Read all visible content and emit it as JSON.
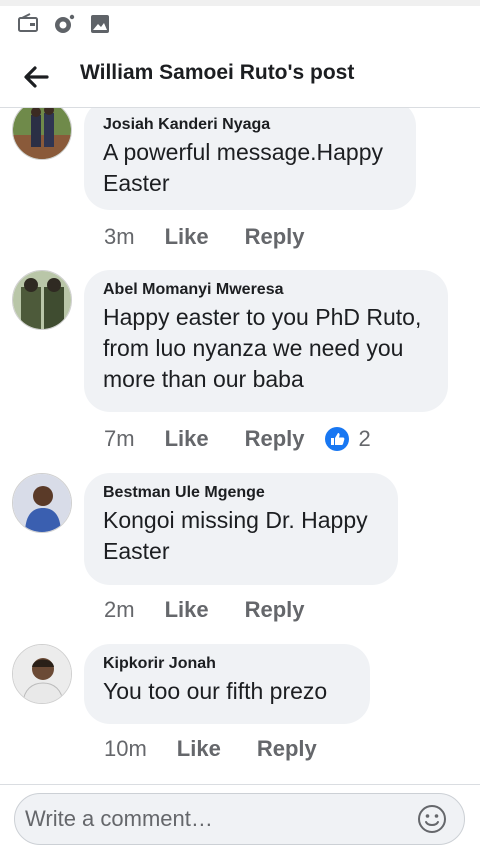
{
  "status_bar": {
    "icons": [
      "wallet-icon",
      "camera-icon",
      "gallery-icon"
    ]
  },
  "header": {
    "title": "William Samoei Ruto's post",
    "back_icon": "back-arrow-icon"
  },
  "comments": [
    {
      "author": "Josiah Kanderi Nyaga",
      "text": "A powerful message.Happy Easter",
      "time": "3m",
      "like_label": "Like",
      "reply_label": "Reply"
    },
    {
      "author": "Abel Momanyi Mweresa",
      "text": "Happy easter to you PhD Ruto, from luo nyanza we need you more than our baba",
      "time": "7m",
      "like_label": "Like",
      "reply_label": "Reply",
      "reaction_count": "2"
    },
    {
      "author": "Bestman Ule Mgenge",
      "text": "Kongoi missing Dr. Happy Easter",
      "time": "2m",
      "like_label": "Like",
      "reply_label": "Reply"
    },
    {
      "author": "Kipkorir Jonah",
      "text": "You too our fifth prezo",
      "time": "10m",
      "like_label": "Like",
      "reply_label": "Reply"
    }
  ],
  "composer": {
    "placeholder": "Write a comment…"
  },
  "colors": {
    "bubble": "#f0f2f5",
    "secondary_text": "#65676b",
    "like_blue": "#1877f2"
  }
}
